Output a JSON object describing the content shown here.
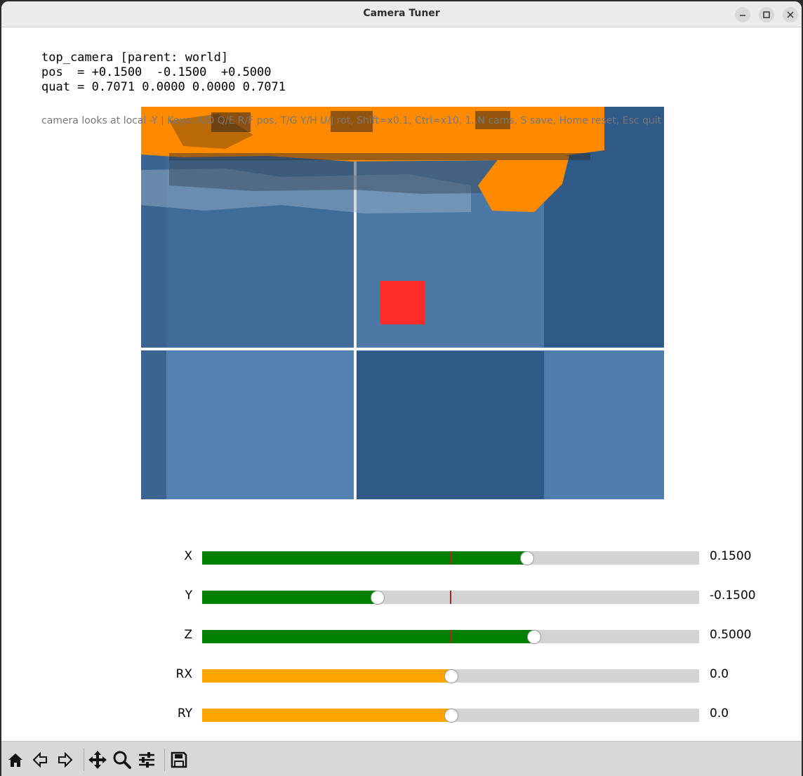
{
  "window": {
    "title": "Camera Tuner"
  },
  "info": {
    "line1": "top_camera [parent: world]",
    "line2": "pos  = +0.1500  -0.1500  +0.5000",
    "line3": "quat = 0.7071 0.0000 0.0000 0.7071"
  },
  "hint": "camera looks at local -Y | Keys: A/D Q/E R/F pos, T/G Y/H U/J rot, Shift=x0.1, Ctrl=x10, 1..N cams, S save, Home reset, Esc quit",
  "sliders": [
    {
      "label": "X",
      "value": "0.1500",
      "fraction": 0.653,
      "color": "green"
    },
    {
      "label": "Y",
      "value": "-0.1500",
      "fraction": 0.351,
      "color": "green"
    },
    {
      "label": "Z",
      "value": "0.5000",
      "fraction": 0.667,
      "color": "green"
    },
    {
      "label": "RX",
      "value": "0.0",
      "fraction": 0.5,
      "color": "orange"
    },
    {
      "label": "RY",
      "value": "0.0",
      "fraction": 0.5,
      "color": "orange"
    }
  ],
  "colors": {
    "fill_position": "#008000",
    "fill_rotation": "#ffa500",
    "track": "#d3d3d3",
    "center_marker": "#b22222",
    "scene_background": "#4c78a6",
    "target": "#ff2a2a",
    "robot": "#ff8a00"
  },
  "toolbar": {
    "icons": [
      "home-icon",
      "back-icon",
      "forward-icon",
      "pan-icon",
      "zoom-icon",
      "configure-subplots-icon",
      "save-icon"
    ]
  }
}
